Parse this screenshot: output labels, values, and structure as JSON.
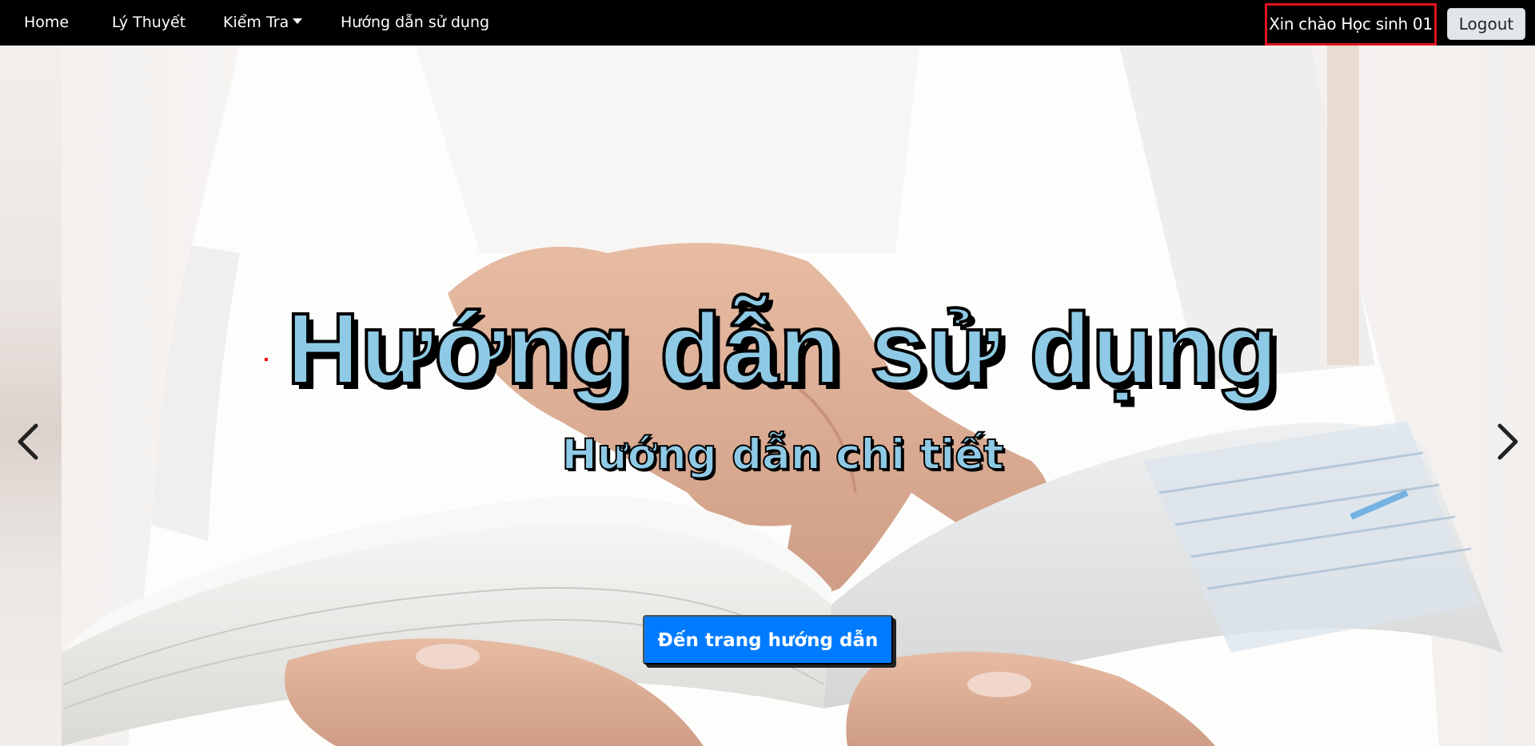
{
  "nav": {
    "home": "Home",
    "ly_thuyet": "Lý Thuyết",
    "kiem_tra": "Kiểm Tra",
    "huong_dan": "Hướng dẫn sử dụng"
  },
  "user": {
    "greeting": "Xin chào Học sinh 01",
    "logout_label": "Logout"
  },
  "hero": {
    "title": "Hướng dẫn sử dụng",
    "subtitle": "Hướng dẫn chi tiết",
    "cta_label": "Đến trang hướng dẫn",
    "background": "hands-holding-open-book-photo"
  },
  "carousel": {
    "prev_icon": "chevron-left-icon",
    "next_icon": "chevron-right-icon"
  },
  "colors": {
    "navbar_bg": "#000000",
    "title_fill": "#8ecae6",
    "cta_bg": "#007bff",
    "greeting_border": "#e0141e"
  }
}
